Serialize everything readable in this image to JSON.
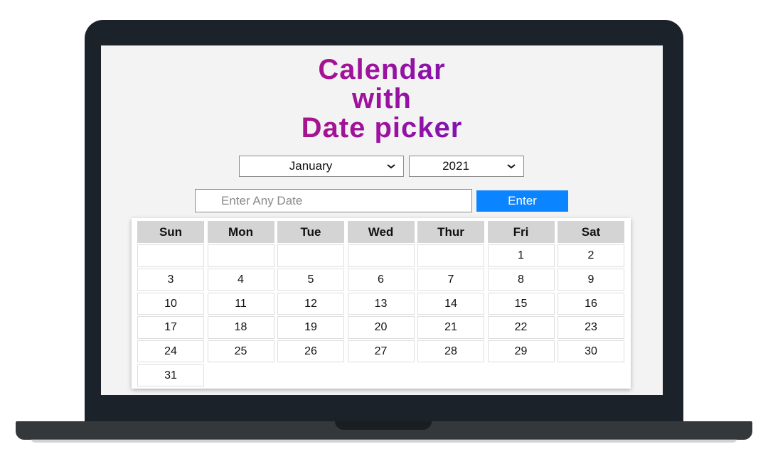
{
  "title": {
    "line1": "Calendar",
    "line2": "with",
    "line3": "Date picker"
  },
  "month_select": {
    "value": "January",
    "icon": "chevron-down-icon"
  },
  "year_select": {
    "value": "2021",
    "icon": "chevron-down-icon"
  },
  "date_input": {
    "placeholder": "Enter Any Date",
    "value": ""
  },
  "enter_button": {
    "label": "Enter",
    "color": "#0a84ff"
  },
  "colors": {
    "title_start": "#c2185b",
    "title_mid": "#9c12a0",
    "title_end": "#3b12d9",
    "header_bg": "#d4d4d4"
  },
  "calendar": {
    "weekdays": [
      "Sun",
      "Mon",
      "Tue",
      "Wed",
      "Thur",
      "Fri",
      "Sat"
    ],
    "weeks": [
      [
        "",
        "",
        "",
        "",
        "",
        "1",
        "2"
      ],
      [
        "3",
        "4",
        "5",
        "6",
        "7",
        "8",
        "9"
      ],
      [
        "10",
        "11",
        "12",
        "13",
        "14",
        "15",
        "16"
      ],
      [
        "17",
        "18",
        "19",
        "20",
        "21",
        "22",
        "23"
      ],
      [
        "24",
        "25",
        "26",
        "27",
        "28",
        "29",
        "30"
      ],
      [
        "31",
        null,
        null,
        null,
        null,
        null,
        null
      ]
    ]
  }
}
